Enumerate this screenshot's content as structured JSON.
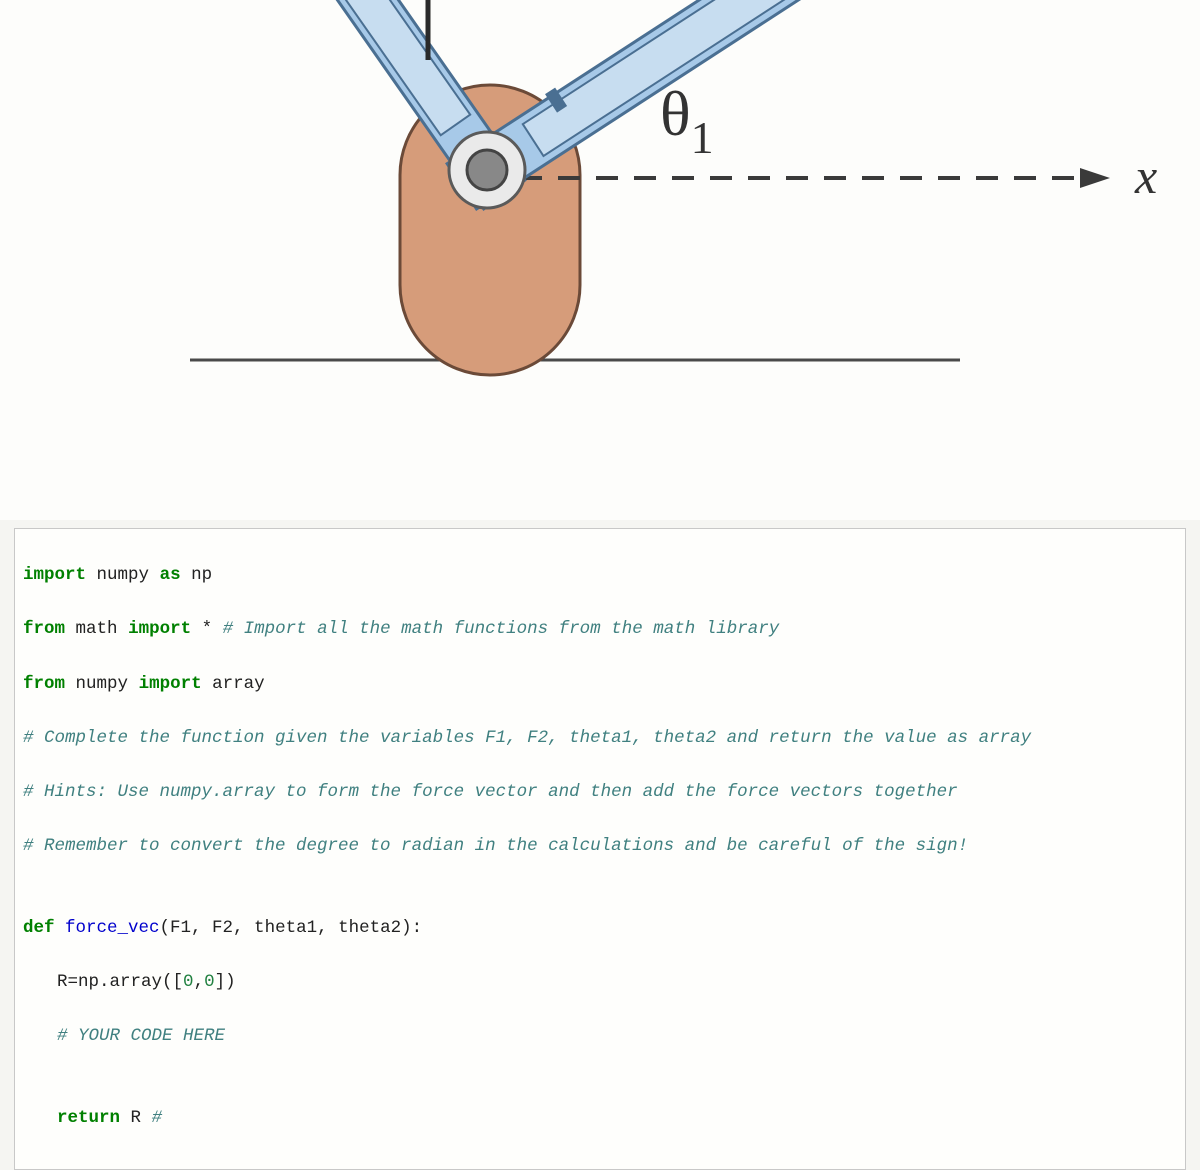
{
  "diagram": {
    "theta_label": "θ",
    "theta_sub": "1",
    "x_axis_label": "x"
  },
  "code": {
    "l1_kw1": "import",
    "l1_mod": "numpy",
    "l1_kw2": "as",
    "l1_alias": "np",
    "l2_kw1": "from",
    "l2_mod": "math",
    "l2_kw2": "import",
    "l2_star": "*",
    "l2_cm": "# Import all the math functions from the math library",
    "l3_kw1": "from",
    "l3_mod": "numpy",
    "l3_kw2": "import",
    "l3_id": "array",
    "l4_cm": "# Complete the function given the variables F1, F2, theta1, theta2 and return the value as array",
    "l5_cm": "# Hints: Use numpy.array to form the force vector and then add the force vectors together",
    "l6_cm": "# Remember to convert the degree to radian in the calculations and be careful of the sign!",
    "blank": "",
    "l7_kw": "def",
    "l7_fn": "force_vec",
    "l7_args": "(F1, F2, theta1, theta2):",
    "l8_lhs": "R=np.",
    "l8_fn": "array",
    "l8_rhs": "([",
    "l8_n1": "0",
    "l8_c": ",",
    "l8_n2": "0",
    "l8_end": "])",
    "l9_cm": "# YOUR CODE HERE",
    "l10_kw": "return",
    "l10_id": "R",
    "l10_cm": "#"
  }
}
